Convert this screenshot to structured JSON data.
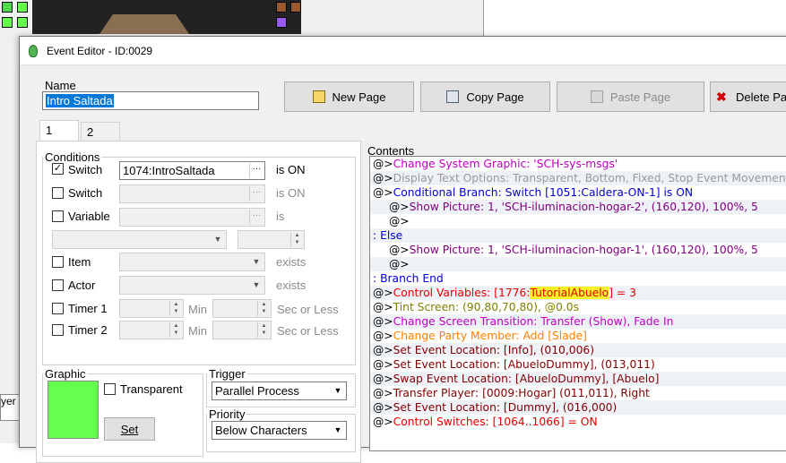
{
  "window": {
    "title": "Event Editor - ID:0029"
  },
  "background": {
    "partial_text": "yer"
  },
  "name_group": {
    "legend": "Name",
    "value": "Intro Saltada"
  },
  "page_buttons": {
    "new_page": "New Page",
    "copy_page": "Copy Page",
    "paste_page": "Paste Page",
    "delete_page": "Delete Pa"
  },
  "tabs": [
    "1",
    "2"
  ],
  "conditions": {
    "legend": "Conditions",
    "switch1": {
      "label": "Switch",
      "checked": true,
      "value": "1074:IntroSaltada",
      "suffix": "is ON"
    },
    "switch2": {
      "label": "Switch",
      "checked": false,
      "value": "",
      "suffix": "is ON"
    },
    "variable": {
      "label": "Variable",
      "checked": false,
      "value": "",
      "suffix": "is"
    },
    "item": {
      "label": "Item",
      "checked": false,
      "suffix": "exists"
    },
    "actor": {
      "label": "Actor",
      "checked": false,
      "suffix": "exists"
    },
    "timer1": {
      "label": "Timer 1",
      "checked": false,
      "min": "Min",
      "sec": "Sec or Less"
    },
    "timer2": {
      "label": "Timer 2",
      "checked": false,
      "min": "Min",
      "sec": "Sec or Less"
    }
  },
  "graphic": {
    "legend": "Graphic",
    "transparent_label": "Transparent",
    "set_label": "Set",
    "color": "#66ff4d"
  },
  "trigger": {
    "legend": "Trigger",
    "value": "Parallel Process"
  },
  "priority": {
    "legend": "Priority",
    "value": "Below Characters"
  },
  "contents": {
    "legend": "Contents",
    "lines": [
      {
        "prefix": "@>",
        "text": "Change System Graphic: 'SCH-sys-msgs'",
        "color": "#c000c0",
        "indent": 0
      },
      {
        "prefix": "@>",
        "text": "Display Text Options: Transparent, Bottom, Fixed, Stop Event Movement",
        "color": "#9a9a9a",
        "indent": 0
      },
      {
        "prefix": "@>",
        "text": "Conditional Branch: Switch [1051:Caldera-ON-1] is ON",
        "color": "#0000d0",
        "indent": 0
      },
      {
        "prefix": "@>",
        "text": "Show Picture: 1, 'SCH-iluminacion-hogar-2', (160,120), 100%, 5",
        "color": "#800080",
        "indent": 1
      },
      {
        "prefix": "@>",
        "text": "",
        "color": "#000000",
        "indent": 1
      },
      {
        "prefix": ":",
        "text": "Else",
        "color": "#0000d0",
        "indent": 0
      },
      {
        "prefix": "@>",
        "text": "Show Picture: 1, 'SCH-iluminacion-hogar-1', (160,120), 100%, 5",
        "color": "#800080",
        "indent": 1
      },
      {
        "prefix": "@>",
        "text": "",
        "color": "#000000",
        "indent": 1
      },
      {
        "prefix": ":",
        "text": "Branch End",
        "color": "#0000d0",
        "indent": 0
      },
      {
        "prefix": "@>",
        "text": "Control Variables: [1776:",
        "highlight": "TutorialAbuelo",
        "after": "] = 3",
        "color": "#e00000",
        "indent": 0
      },
      {
        "prefix": "@>",
        "text": "Tint Screen: (90,80,70,80), @0.0s",
        "color": "#808000",
        "indent": 0
      },
      {
        "prefix": "@>",
        "text": "Change Screen Transition: Transfer (Show), Fade In",
        "color": "#c000c0",
        "indent": 0
      },
      {
        "prefix": "@>",
        "text": "Change Party Member: Add [Slade]",
        "color": "#ff8000",
        "indent": 0
      },
      {
        "prefix": "@>",
        "text": "Set Event Location: [Info], (010,006)",
        "color": "#800000",
        "indent": 0
      },
      {
        "prefix": "@>",
        "text": "Set Event Location: [AbueloDummy], (013,011)",
        "color": "#800000",
        "indent": 0
      },
      {
        "prefix": "@>",
        "text": "Swap Event Location: [AbueloDummy], [Abuelo]",
        "color": "#800000",
        "indent": 0
      },
      {
        "prefix": "@>",
        "text": "Transfer Player: [0009:Hogar] (011,011), Right",
        "color": "#800000",
        "indent": 0
      },
      {
        "prefix": "@>",
        "text": "Set Event Location: [Dummy], (016,000)",
        "color": "#800000",
        "indent": 0
      },
      {
        "prefix": "@>",
        "text": "Control Switches: [1064..1066] = ON",
        "color": "#e00000",
        "indent": 0
      }
    ]
  }
}
